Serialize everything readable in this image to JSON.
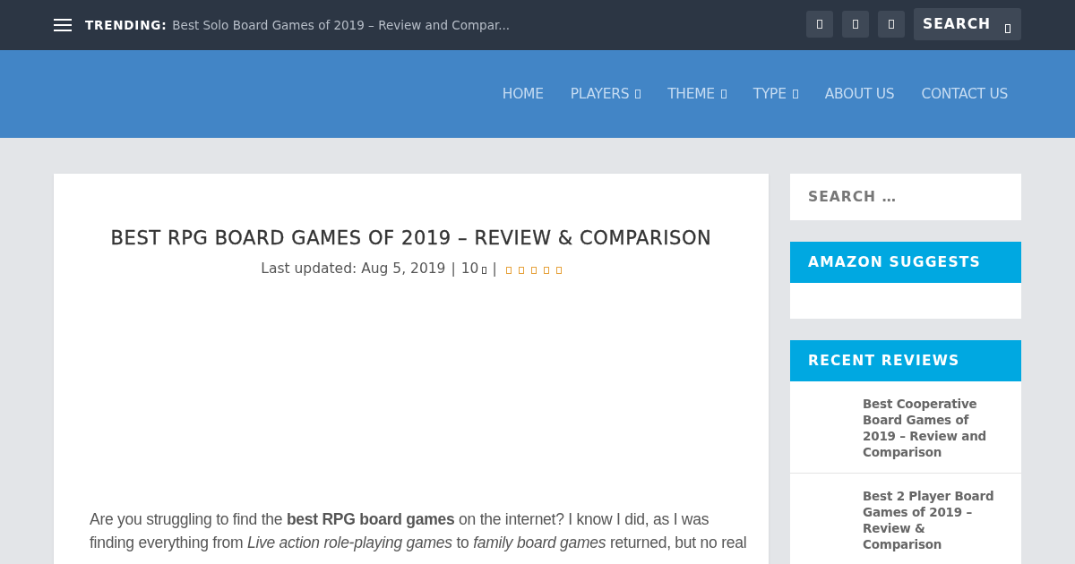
{
  "top_bar": {
    "trending_label": "TRENDING:",
    "trending_link": "Best Solo Board Games of 2019 – Review and Compar...",
    "search": {
      "placeholder": "SEARCH"
    }
  },
  "nav": [
    {
      "label": "HOME",
      "has_dropdown": false
    },
    {
      "label": "PLAYERS",
      "has_dropdown": true
    },
    {
      "label": "THEME",
      "has_dropdown": true
    },
    {
      "label": "TYPE",
      "has_dropdown": true
    },
    {
      "label": "ABOUT US",
      "has_dropdown": false
    },
    {
      "label": "CONTACT US",
      "has_dropdown": false
    }
  ],
  "article": {
    "title": "BEST RPG BOARD GAMES OF 2019 – REVIEW & COMPARISON",
    "updated": "Last updated: Aug 5, 2019",
    "separator_1": "|",
    "comments": "10",
    "separator_2": "|",
    "paragraph": "Are you struggling to find the **best RPG board games** on the internet? I know I did, as I was finding everything from *Live action role-playing games* to *family board games* returned, but no real"
  },
  "sidebar": {
    "search": {
      "placeholder": "SEARCH …"
    },
    "widgets": [
      {
        "kind": "empty",
        "title": "AMAZON SUGGESTS"
      },
      {
        "kind": "reviews",
        "title": "RECENT REVIEWS",
        "items": [
          {
            "title": "Best Cooperative Board Games of 2019 – Review and Comparison"
          },
          {
            "title": "Best 2 Player Board Games of 2019 – Review & Comparison"
          }
        ]
      }
    ]
  }
}
